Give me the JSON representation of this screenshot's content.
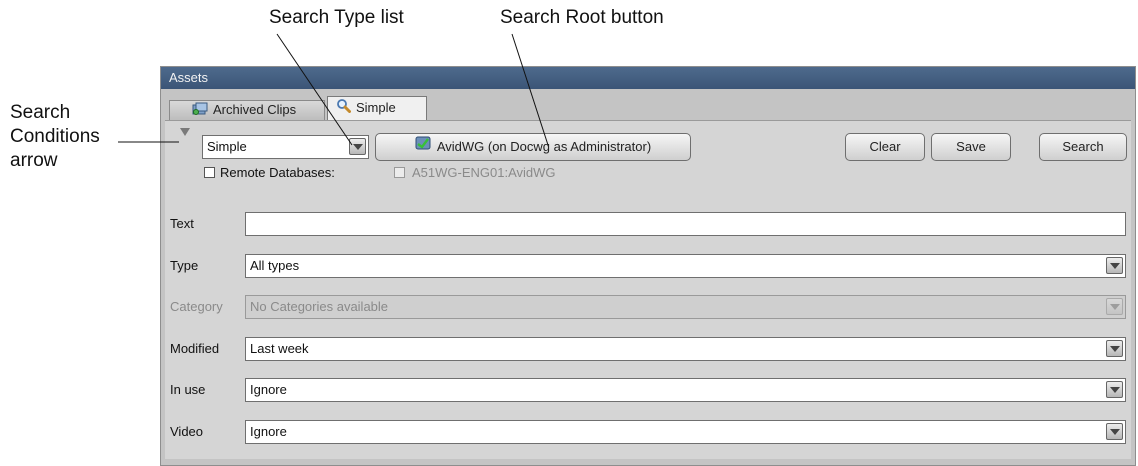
{
  "callouts": {
    "search_type_list": "Search Type list",
    "search_root_button": "Search Root button",
    "search_conditions_arrow_lines": [
      "Search",
      "Conditions",
      "arrow"
    ]
  },
  "window": {
    "title": "Assets"
  },
  "tabs": [
    {
      "label": "Archived Clips",
      "icon": "archived-clips-icon",
      "active": false
    },
    {
      "label": "Simple",
      "icon": "magnifier-icon",
      "active": true
    }
  ],
  "toolbar": {
    "search_type_value": "Simple",
    "search_root_label": "AvidWG (on Docwg as Administrator)",
    "clear_label": "Clear",
    "save_label": "Save",
    "search_label": "Search"
  },
  "remote": {
    "label": "Remote Databases:",
    "checked": false,
    "database_label": "A51WG-ENG01:AvidWG",
    "database_checked": false
  },
  "fields": {
    "text": {
      "label": "Text",
      "value": ""
    },
    "type": {
      "label": "Type",
      "value": "All types"
    },
    "category": {
      "label": "Category",
      "value": "No Categories available",
      "disabled": true
    },
    "modified": {
      "label": "Modified",
      "value": "Last week"
    },
    "in_use": {
      "label": "In use",
      "value": "Ignore"
    },
    "video": {
      "label": "Video",
      "value": "Ignore"
    }
  },
  "colors": {
    "titlebar": "#3f5a7c",
    "panel": "#d5d5d5",
    "accent_icon": "#2e8b2e"
  }
}
